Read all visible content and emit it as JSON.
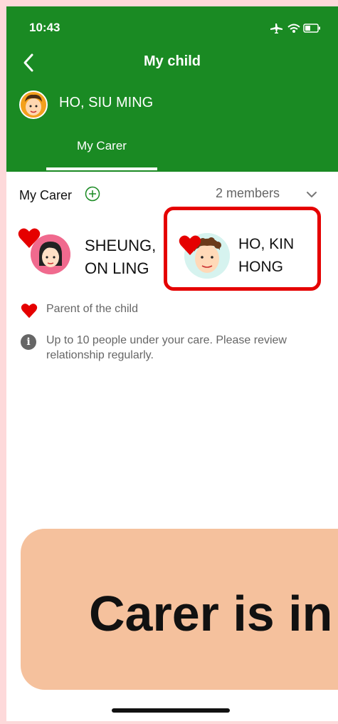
{
  "status_bar": {
    "time": "10:43"
  },
  "header": {
    "title": "My child",
    "child_name": "HO, SIU MING",
    "tab_label": "My Carer"
  },
  "section": {
    "title": "My Carer",
    "member_count": "2 members"
  },
  "carers": [
    {
      "name_line1": "SHEUNG,",
      "name_line2": "ON LING",
      "is_parent": true
    },
    {
      "name_line1": "HO, KIN",
      "name_line2": "HONG",
      "is_parent": true,
      "highlighted": true
    }
  ],
  "legend": {
    "text": "Parent of the child"
  },
  "info": {
    "text": "Up to 10 people under your care. Please review relationship regularly."
  },
  "banner": {
    "text": "Carer is in"
  },
  "colors": {
    "header_green": "#1a8a23",
    "heart_red": "#e50000",
    "banner_bg": "#f5c19d",
    "highlight_red": "#e50000"
  }
}
